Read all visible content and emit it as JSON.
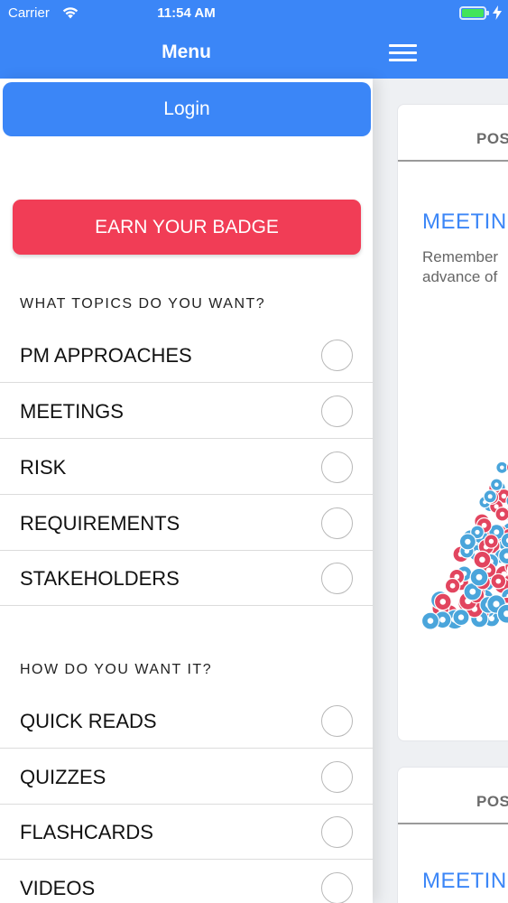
{
  "status_bar": {
    "carrier": "Carrier",
    "time": "11:54 AM",
    "wifi_icon": "wifi-icon",
    "battery_icon": "battery-icon",
    "charging_icon": "bolt-icon",
    "battery_color": "#43e45a"
  },
  "header": {
    "menu_title": "Menu",
    "hamburger_icon": "hamburger-icon",
    "color": "#3b86f7"
  },
  "menu": {
    "login_label": "Login",
    "badge_label": "EARN YOUR BADGE",
    "badge_color": "#f13d56",
    "topics_heading": "WHAT TOPICS DO YOU WANT?",
    "topics": [
      {
        "label": "PM APPROACHES",
        "checked": false
      },
      {
        "label": "MEETINGS",
        "checked": false
      },
      {
        "label": "RISK",
        "checked": false
      },
      {
        "label": "REQUIREMENTS",
        "checked": false
      },
      {
        "label": "STAKEHOLDERS",
        "checked": false
      }
    ],
    "formats_heading": "HOW DO YOU WANT IT?",
    "formats": [
      {
        "label": "QUICK READS",
        "checked": false
      },
      {
        "label": "QUIZZES",
        "checked": false
      },
      {
        "label": "FLASHCARDS",
        "checked": false
      },
      {
        "label": "VIDEOS",
        "checked": false
      }
    ]
  },
  "content": {
    "cards": [
      {
        "header": "POS",
        "title": "MEETIN",
        "excerpt_line1": "Remember",
        "excerpt_line2": "advance of",
        "image_icon": "reactions-image"
      },
      {
        "header": "POS",
        "title": "MEETIN"
      }
    ]
  }
}
